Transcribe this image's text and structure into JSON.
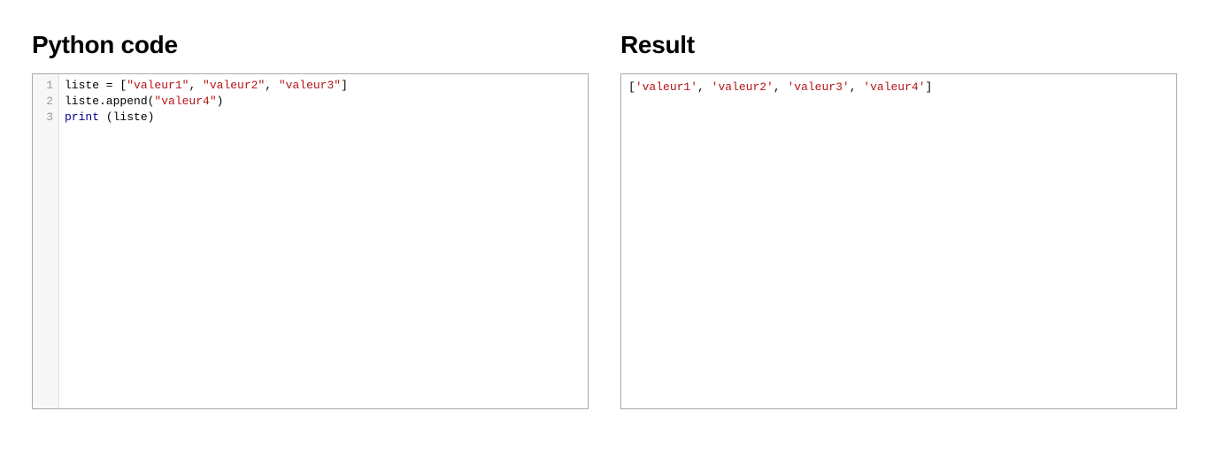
{
  "left": {
    "title": "Python code",
    "lines": [
      {
        "n": "1",
        "tokens": [
          {
            "cls": "tok-plain",
            "text": "liste = ["
          },
          {
            "cls": "tok-str",
            "text": "\"valeur1\""
          },
          {
            "cls": "tok-plain",
            "text": ", "
          },
          {
            "cls": "tok-str",
            "text": "\"valeur2\""
          },
          {
            "cls": "tok-plain",
            "text": ", "
          },
          {
            "cls": "tok-str",
            "text": "\"valeur3\""
          },
          {
            "cls": "tok-plain",
            "text": "]"
          }
        ]
      },
      {
        "n": "2",
        "tokens": [
          {
            "cls": "tok-plain",
            "text": "liste.append("
          },
          {
            "cls": "tok-str",
            "text": "\"valeur4\""
          },
          {
            "cls": "tok-plain",
            "text": ")"
          }
        ]
      },
      {
        "n": "3",
        "tokens": [
          {
            "cls": "tok-kw",
            "text": "print"
          },
          {
            "cls": "tok-plain",
            "text": " (liste)"
          }
        ]
      }
    ]
  },
  "right": {
    "title": "Result",
    "output_tokens": [
      {
        "cls": "tok-punc",
        "text": "["
      },
      {
        "cls": "tok-str",
        "text": "'valeur1'"
      },
      {
        "cls": "tok-punc",
        "text": ", "
      },
      {
        "cls": "tok-str",
        "text": "'valeur2'"
      },
      {
        "cls": "tok-punc",
        "text": ", "
      },
      {
        "cls": "tok-str",
        "text": "'valeur3'"
      },
      {
        "cls": "tok-punc",
        "text": ", "
      },
      {
        "cls": "tok-str",
        "text": "'valeur4'"
      },
      {
        "cls": "tok-punc",
        "text": "]"
      }
    ]
  }
}
